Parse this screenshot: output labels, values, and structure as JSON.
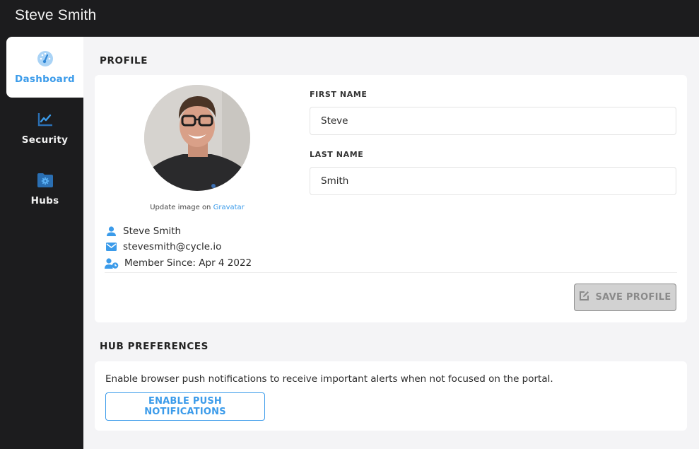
{
  "header": {
    "title": "Steve Smith"
  },
  "sidebar": {
    "items": [
      {
        "label": "Dashboard",
        "icon": "dashboard-gauge-icon",
        "active": true
      },
      {
        "label": "Security",
        "icon": "line-chart-icon",
        "active": false
      },
      {
        "label": "Hubs",
        "icon": "folder-gear-icon",
        "active": false
      }
    ]
  },
  "profile": {
    "section_title": "PROFILE",
    "avatar_alt": "Profile photo",
    "gravatar_prefix": "Update image on ",
    "gravatar_link": "Gravatar",
    "name": "Steve Smith",
    "email": "stevesmith@cycle.io",
    "member_since": "Member Since: Apr 4 2022",
    "first_name_label": "FIRST NAME",
    "first_name_value": "Steve",
    "last_name_label": "LAST NAME",
    "last_name_value": "Smith",
    "save_label": "SAVE PROFILE"
  },
  "hub_preferences": {
    "section_title": "HUB PREFERENCES",
    "description": "Enable browser push notifications to receive important alerts when not focused on the portal.",
    "button_label": "ENABLE PUSH NOTIFICATIONS"
  },
  "colors": {
    "accent": "#3b9bea",
    "sidebar_bg": "#1c1c1e",
    "main_bg": "#f4f4f6",
    "disabled_button_bg": "#d2d2d2"
  }
}
